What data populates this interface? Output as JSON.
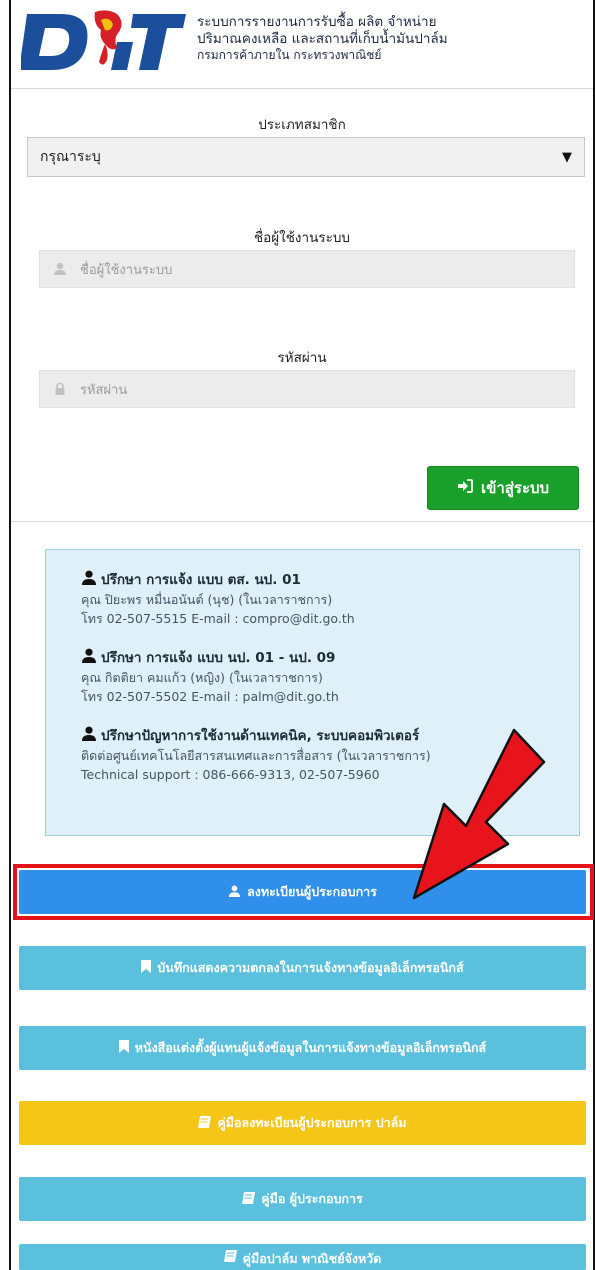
{
  "header": {
    "logo_text": "DIT",
    "title_line1": "ระบบการรายงานการรับซื้อ ผลิต จำหน่าย",
    "title_line2": "ปริมาณคงเหลือ และสถานที่เก็บน้ำมันปาล์ม",
    "title_line3": "กรมการค้าภายใน กระทรวงพาณิชย์"
  },
  "form": {
    "member_type_label": "ประเภทสมาชิก",
    "member_type_value": "กรุณาระบุ",
    "username_label": "ชื่อผู้ใช้งานระบบ",
    "username_placeholder": "ชื่อผู้ใช้งานระบบ",
    "password_label": "รหัสผ่าน",
    "password_placeholder": "รหัสผ่าน",
    "login_label": "เข้าสู่ระบบ"
  },
  "info": {
    "groups": [
      {
        "title": "ปรึกษา การแจ้ง แบบ ตส. นป. 01",
        "line1": "คุณ ปิยะพร หมื่นอนันต์ (นุช) (ในเวลาราชการ)",
        "line2": "โทร 02-507-5515 E-mail : compro@dit.go.th"
      },
      {
        "title": "ปรึกษา การแจ้ง แบบ นป. 01 - นป. 09",
        "line1": "คุณ กิตติยา คมแก้ว (หญิง) (ในเวลาราชการ)",
        "line2": "โทร 02-507-5502 E-mail : palm@dit.go.th"
      },
      {
        "title": "ปรึกษาปัญหาการใช้งานด้านเทคนิค, ระบบคอมพิวเตอร์",
        "line1": "ติดต่อศูนย์เทคโนโลยีสารสนเทศและการสื่อสาร (ในเวลาราชการ)",
        "line2": "Technical support : 086-666-9313, 02-507-5960"
      }
    ]
  },
  "buttons": {
    "register": "ลงทะเบียนผู้ประกอบการ",
    "agreement": "บันทึกแสดงความตกลงในการแจ้งทางข้อมูลอิเล็กทรอนิกส์",
    "appointment": "หนังสือแต่งตั้งผู้แทนผู้แจ้งข้อมูลในการแจ้งทางข้อมูลอิเล็กทรอนิกส์",
    "manual_register": "คู่มือลงทะเบียนผู้ประกอบการ ปาล์ม",
    "manual_operator": "คู่มือ ผู้ประกอบการ",
    "manual_province": "คู่มือปาล์ม พาณิชย์จังหวัด"
  },
  "colors": {
    "login": "#19a02b",
    "register": "#2f8fea",
    "info_button": "#5bc0de",
    "manual_register": "#f5c518",
    "highlight": "#e3131c"
  }
}
